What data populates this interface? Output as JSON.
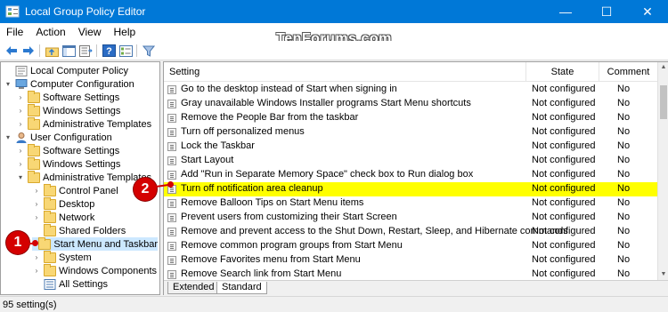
{
  "window": {
    "title": "Local Group Policy Editor",
    "controls": {
      "minimize": "—",
      "maximize": "☐",
      "close": "✕"
    }
  },
  "watermark": "TenForums.com",
  "menubar": {
    "items": [
      {
        "label": "File"
      },
      {
        "label": "Action"
      },
      {
        "label": "View"
      },
      {
        "label": "Help"
      }
    ]
  },
  "toolbar": {
    "buttons": [
      {
        "icon": "back-arrow-icon",
        "glyph": "🡄"
      },
      {
        "icon": "forward-arrow-icon",
        "glyph": "🡆"
      },
      {
        "icon": "up-folder-icon",
        "glyph": ""
      },
      {
        "icon": "show-hide-tree-icon",
        "glyph": ""
      },
      {
        "icon": "export-list-icon",
        "glyph": ""
      },
      {
        "icon": "help-icon",
        "glyph": "?"
      },
      {
        "icon": "properties-icon",
        "glyph": ""
      },
      {
        "icon": "filter-icon",
        "glyph": ""
      }
    ]
  },
  "tree": {
    "items": [
      {
        "label": "Local Computer Policy",
        "expander": "",
        "icon": "computer-policy-icon"
      },
      {
        "label": "Computer Configuration",
        "expander": "▾",
        "icon": "computer-icon"
      },
      {
        "label": "Software Settings",
        "expander": "›",
        "icon": "folder-icon"
      },
      {
        "label": "Windows Settings",
        "expander": "›",
        "icon": "folder-icon"
      },
      {
        "label": "Administrative Templates",
        "expander": "›",
        "icon": "folder-icon"
      },
      {
        "label": "User Configuration",
        "expander": "▾",
        "icon": "user-icon"
      },
      {
        "label": "Software Settings",
        "expander": "›",
        "icon": "folder-icon"
      },
      {
        "label": "Windows Settings",
        "expander": "›",
        "icon": "folder-icon"
      },
      {
        "label": "Administrative Templates",
        "expander": "▾",
        "icon": "folder-icon"
      },
      {
        "label": "Control Panel",
        "expander": "›",
        "icon": "folder-icon"
      },
      {
        "label": "Desktop",
        "expander": "›",
        "icon": "folder-icon"
      },
      {
        "label": "Network",
        "expander": "›",
        "icon": "folder-icon"
      },
      {
        "label": "Shared Folders",
        "expander": "",
        "icon": "folder-icon"
      },
      {
        "label": "Start Menu and Taskbar",
        "expander": "›",
        "icon": "folder-icon",
        "selected": true
      },
      {
        "label": "System",
        "expander": "›",
        "icon": "folder-icon"
      },
      {
        "label": "Windows Components",
        "expander": "›",
        "icon": "folder-icon"
      },
      {
        "label": "All Settings",
        "expander": "",
        "icon": "all-settings-icon"
      }
    ]
  },
  "list": {
    "columns": {
      "setting": "Setting",
      "state": "State",
      "comment": "Comment"
    },
    "rows": [
      {
        "setting": "Go to the desktop instead of Start when signing in",
        "state": "Not configured",
        "comment": "No"
      },
      {
        "setting": "Gray unavailable Windows Installer programs Start Menu shortcuts",
        "state": "Not configured",
        "comment": "No"
      },
      {
        "setting": "Remove the People Bar from the taskbar",
        "state": "Not configured",
        "comment": "No"
      },
      {
        "setting": "Turn off personalized menus",
        "state": "Not configured",
        "comment": "No"
      },
      {
        "setting": "Lock the Taskbar",
        "state": "Not configured",
        "comment": "No"
      },
      {
        "setting": "Start Layout",
        "state": "Not configured",
        "comment": "No"
      },
      {
        "setting": "Add \"Run in Separate Memory Space\" check box to Run dialog box",
        "state": "Not configured",
        "comment": "No"
      },
      {
        "setting": "Turn off notification area cleanup",
        "state": "Not configured",
        "comment": "No",
        "highlight": true
      },
      {
        "setting": "Remove Balloon Tips on Start Menu items",
        "state": "Not configured",
        "comment": "No"
      },
      {
        "setting": "Prevent users from customizing their Start Screen",
        "state": "Not configured",
        "comment": "No"
      },
      {
        "setting": "Remove and prevent access to the Shut Down, Restart, Sleep, and Hibernate commands",
        "state": "Not configured",
        "comment": "No"
      },
      {
        "setting": "Remove common program groups from Start Menu",
        "state": "Not configured",
        "comment": "No"
      },
      {
        "setting": "Remove Favorites menu from Start Menu",
        "state": "Not configured",
        "comment": "No"
      },
      {
        "setting": "Remove Search link from Start Menu",
        "state": "Not configured",
        "comment": "No"
      }
    ]
  },
  "tabs": [
    {
      "label": "Extended"
    },
    {
      "label": "Standard",
      "active": true
    }
  ],
  "statusbar": {
    "text": "95 setting(s)"
  },
  "callouts": [
    {
      "label": "1"
    },
    {
      "label": "2"
    }
  ],
  "colors": {
    "titlebar": "#0078d7",
    "highlight": "#ffff00",
    "selection": "#cce8ff",
    "callout": "#d40000"
  }
}
